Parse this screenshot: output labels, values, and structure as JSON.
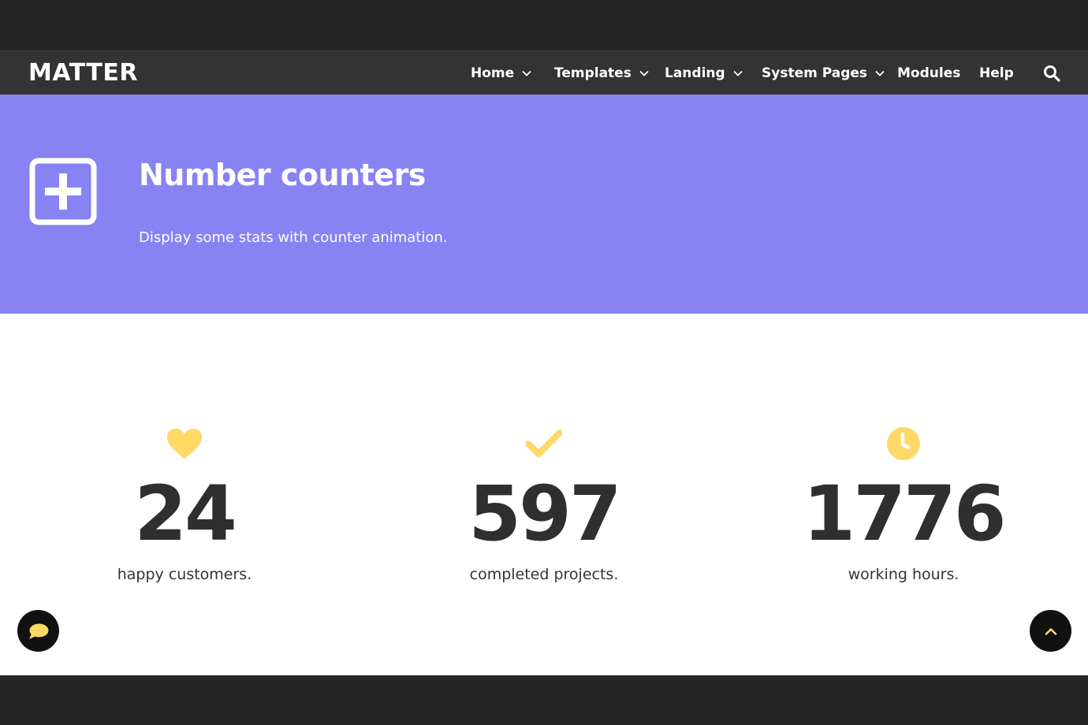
{
  "brand": {
    "logo_text": "MATTER"
  },
  "nav": {
    "items": [
      {
        "label": "Home",
        "has_dropdown": true
      },
      {
        "label": "Templates",
        "has_dropdown": true
      },
      {
        "label": "Landing",
        "has_dropdown": true
      },
      {
        "label": "System Pages",
        "has_dropdown": true
      },
      {
        "label": "Modules",
        "has_dropdown": false
      },
      {
        "label": "Help",
        "has_dropdown": false
      }
    ],
    "search_icon": "search-icon"
  },
  "hero": {
    "icon": "plus-square-icon",
    "title": "Number counters",
    "subtitle": "Display some stats with counter animation."
  },
  "stats": [
    {
      "icon": "heart-icon",
      "value": "24",
      "label": "happy customers."
    },
    {
      "icon": "check-icon",
      "value": "597",
      "label": "completed projects."
    },
    {
      "icon": "clock-icon",
      "value": "1776",
      "label": "working hours."
    }
  ],
  "buttons": {
    "chat_icon": "chat-bubble-icon",
    "scroll_top_icon": "chevron-up-icon"
  },
  "colors": {
    "accent": "#ffd866",
    "hero_bg": "#8783f3",
    "nav_bg": "#333333",
    "page_bg": "#262626",
    "text_dark": "#2f2f2f"
  }
}
